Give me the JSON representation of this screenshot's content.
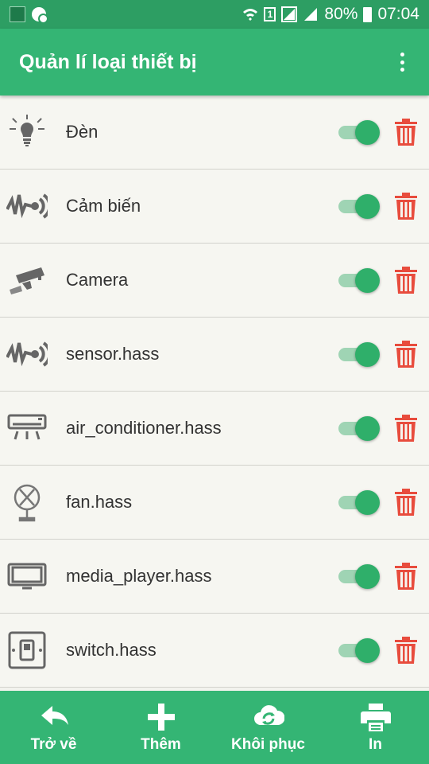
{
  "status_bar": {
    "battery": "80%",
    "time": "07:04",
    "sim": "1"
  },
  "app_bar": {
    "title": "Quản lí loại thiết bị",
    "menu_icon": "more-vert-icon"
  },
  "devices": [
    {
      "label": "Đèn",
      "icon": "lightbulb-icon",
      "enabled": true
    },
    {
      "label": "Cảm biến",
      "icon": "sensor-icon",
      "enabled": true
    },
    {
      "label": "Camera",
      "icon": "camera-icon",
      "enabled": true
    },
    {
      "label": "sensor.hass",
      "icon": "sensor-icon",
      "enabled": true
    },
    {
      "label": "air_conditioner.hass",
      "icon": "air-conditioner-icon",
      "enabled": true
    },
    {
      "label": "fan.hass",
      "icon": "fan-icon",
      "enabled": true
    },
    {
      "label": "media_player.hass",
      "icon": "tv-icon",
      "enabled": true
    },
    {
      "label": "switch.hass",
      "icon": "switch-icon",
      "enabled": true
    }
  ],
  "bottom_bar": {
    "back": {
      "label": "Trở về",
      "icon": "back-arrow-icon"
    },
    "add": {
      "label": "Thêm",
      "icon": "plus-icon"
    },
    "restore": {
      "label": "Khôi phục",
      "icon": "cloud-sync-icon"
    },
    "print": {
      "label": "In",
      "icon": "printer-icon"
    }
  },
  "colors": {
    "primary": "#34b574",
    "status_bar": "#2d9e63",
    "delete": "#e84c3d",
    "toggle_on": "#2faf6a"
  }
}
